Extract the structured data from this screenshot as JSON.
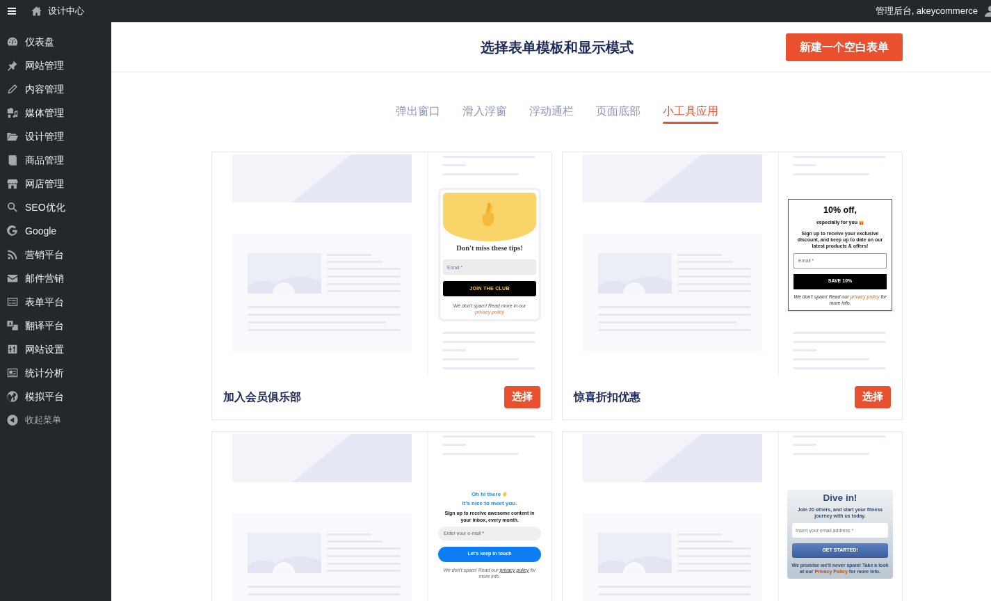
{
  "top_bar": {
    "site_title": "设计中心",
    "account": "管理后台, akeycommerce"
  },
  "sidebar": {
    "items": [
      {
        "label": "仪表盘"
      },
      {
        "label": "网站管理"
      },
      {
        "label": "内容管理"
      },
      {
        "label": "媒体管理"
      },
      {
        "label": "设计管理"
      },
      {
        "label": "商品管理"
      },
      {
        "label": "网店管理"
      },
      {
        "label": "SEO优化"
      },
      {
        "label": "Google"
      },
      {
        "label": "营销平台"
      },
      {
        "label": "邮件营销"
      },
      {
        "label": "表单平台"
      },
      {
        "label": "翻译平台"
      },
      {
        "label": "网站设置"
      },
      {
        "label": "统计分析"
      },
      {
        "label": "模拟平台"
      }
    ],
    "collapse_label": "收起菜单"
  },
  "header": {
    "title": "选择表单模板和显示模式",
    "new_form_button": "新建一个空白表单"
  },
  "tabs": [
    {
      "label": "弹出窗口",
      "selected": false
    },
    {
      "label": "滑入浮窗",
      "selected": false
    },
    {
      "label": "浮动通栏",
      "selected": false
    },
    {
      "label": "页面底部",
      "selected": false
    },
    {
      "label": "小工具应用",
      "selected": true
    }
  ],
  "cards": [
    {
      "title": "加入会员俱乐部",
      "button": "选择",
      "widget": {
        "kind": "banner",
        "heading": "Don't miss these tips!",
        "email_placeholder": "Email *",
        "submit": "JOIN THE CLUB",
        "footnote": {
          "before": "We don't spam! Read more in our",
          "link": "privacy policy"
        }
      }
    },
    {
      "title": "惊喜折扣优惠",
      "button": "选择",
      "widget": {
        "kind": "boxed",
        "heading": "10% off,",
        "subheading": "especially for you",
        "body": "Sign up to receive your exclusive discount, and keep up to date on our latest products & offers!",
        "email_placeholder": "Email *",
        "submit": "SAVE 10%",
        "footnote": {
          "before": "We don't spam! Read our",
          "link": "privacy policy",
          "after": "for more info."
        }
      }
    },
    {
      "widget": {
        "kind": "plain",
        "heading": "Oh hi there",
        "subheading": "It's nice to meet you.",
        "body": "Sign up to receive awesome content in your inbox, every month.",
        "email_placeholder": "Enter your e-mail *",
        "submit": "Let's keep in touch",
        "footnote": {
          "before": "We don't spam! Read our",
          "link": "privacy policy",
          "after": "for more info."
        }
      }
    },
    {
      "widget": {
        "kind": "photo",
        "heading": "Dive in!",
        "body": "Join 20 others, and start your fitness journey with us today.",
        "email_placeholder": "Insert your email address *",
        "submit": "GET STARTED!",
        "footnote": {
          "before": "We promise we'll never spam! Take a look at our",
          "link": "Privacy Policy",
          "after": "for more info."
        }
      }
    }
  ]
}
